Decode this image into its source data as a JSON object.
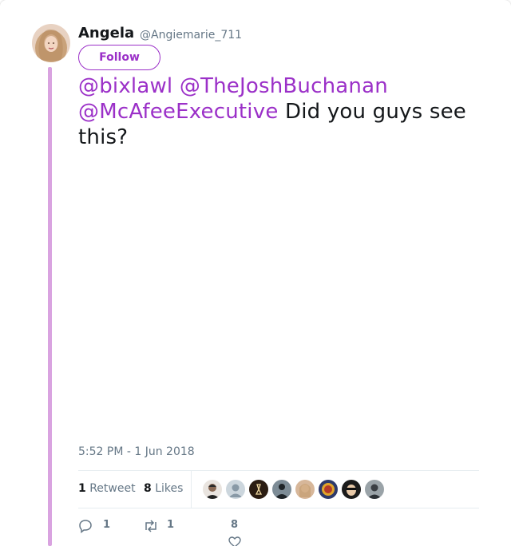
{
  "author": {
    "name": "Angela",
    "handle": "@Angiemarie_711",
    "follow_label": "Follow"
  },
  "tweet": {
    "mentions": [
      "@bixlawl",
      "@TheJoshBuchanan",
      "@McAfeeExecutive"
    ],
    "text": "Did you guys see this?",
    "timestamp": "5:52 PM - 1 Jun 2018"
  },
  "stats": {
    "retweet_count": "1",
    "retweet_label": "Retweet",
    "like_count": "8",
    "like_label": "Likes"
  },
  "actions": {
    "reply_count": "1",
    "retweet_count": "1",
    "like_count": "8"
  },
  "colors": {
    "accent": "#9b30c8",
    "thread_line": "#d9a3e0",
    "text": "#14171a",
    "muted": "#657786"
  }
}
